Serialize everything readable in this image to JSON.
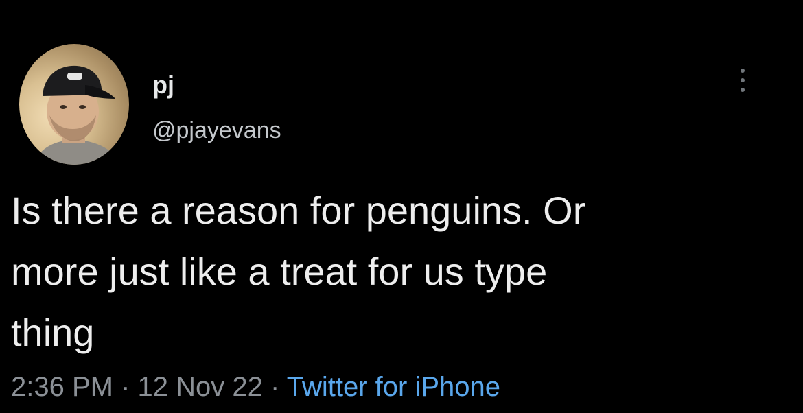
{
  "author": {
    "display_name": "pj",
    "handle": "@pjayevans",
    "avatar_icon": "user-avatar"
  },
  "more_button": {
    "icon": "more-vertical-icon"
  },
  "tweet": {
    "text": "Is there a reason for penguins. Or\nmore just like a treat for us type\nthing"
  },
  "meta": {
    "time": "2:36 PM",
    "separator": "·",
    "date": "12 Nov 22",
    "source": "Twitter for iPhone"
  },
  "colors": {
    "background": "#000000",
    "text": "#e7e9ea",
    "secondary": "#8b9096",
    "link": "#5aa7ec"
  }
}
